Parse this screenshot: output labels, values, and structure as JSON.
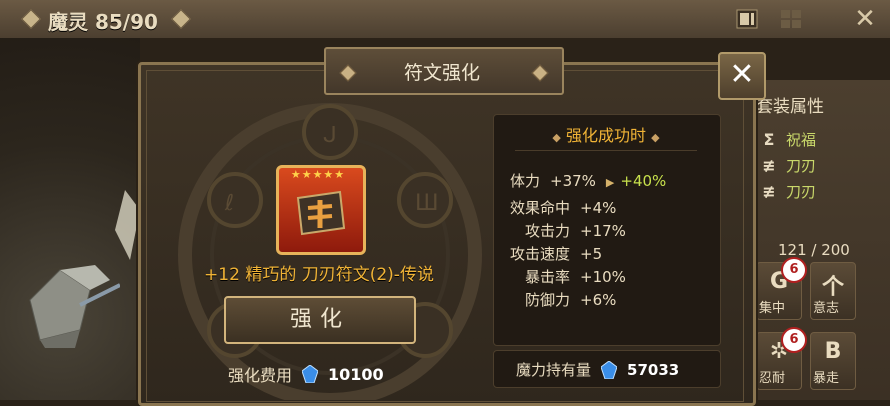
{
  "topbar": {
    "title": "魔灵 85/90",
    "icons": [
      "diamond-icon",
      "list-view-icon",
      "grid-view-icon",
      "close-icon"
    ]
  },
  "dialog": {
    "title": "符文强化",
    "close_icon": "close-icon"
  },
  "rune": {
    "stars": "★★★★★",
    "name": "+12 精巧的 刀刃符文(2)-传说",
    "enhance_label": "强化",
    "cost_label": "强化费用",
    "cost_value": "10100"
  },
  "success": {
    "title": "强化成功时",
    "stats": [
      {
        "key": "体力",
        "value": "+37%",
        "next": "+40%"
      },
      {
        "key": "效果命中",
        "value": "+4%"
      },
      {
        "key": "攻击力",
        "value": "+17%"
      },
      {
        "key": "攻击速度",
        "value": "+5"
      },
      {
        "key": "暴击率",
        "value": "+10%"
      },
      {
        "key": "防御力",
        "value": "+6%"
      }
    ],
    "mana_label": "魔力持有量",
    "mana_value": "57033"
  },
  "set_panel": {
    "title": "套装属性",
    "items": [
      {
        "icon": "Σ",
        "label": "祝福"
      },
      {
        "icon": "≢",
        "label": "刀刃"
      },
      {
        "icon": "≢",
        "label": "刀刃"
      }
    ],
    "count": "121 / 200",
    "slots": [
      {
        "glyph": "G",
        "label": "集中",
        "badge": "6"
      },
      {
        "glyph": "个",
        "label": "意志"
      },
      {
        "glyph": "✲",
        "label": "忍耐",
        "badge": "6"
      },
      {
        "glyph": "B",
        "label": "暴走"
      }
    ]
  },
  "colors": {
    "accent_gold": "#f0b336",
    "stat_green": "#c7e04c",
    "panel_bg": "#3f3426",
    "rune_red": "#d94a1e"
  }
}
